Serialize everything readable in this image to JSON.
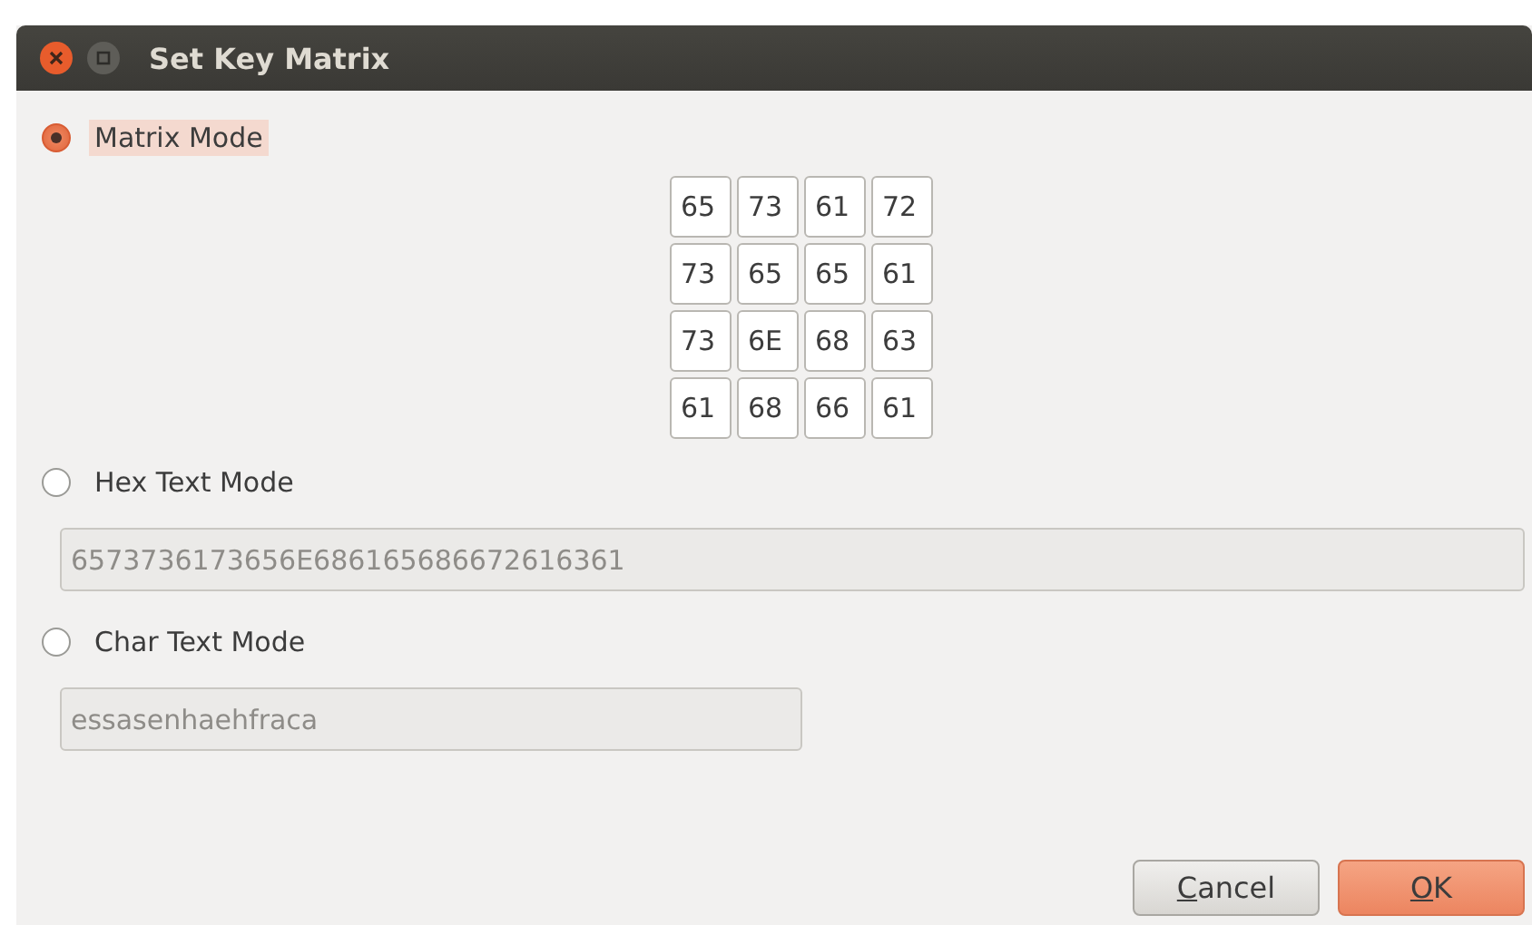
{
  "window": {
    "title": "Set Key Matrix"
  },
  "modes": [
    {
      "kind": "matrix",
      "label": "Matrix Mode",
      "selected": true,
      "focused": true,
      "matrix": [
        [
          "65",
          "73",
          "61",
          "72"
        ],
        [
          "73",
          "65",
          "65",
          "61"
        ],
        [
          "73",
          "6E",
          "68",
          "63"
        ],
        [
          "61",
          "68",
          "66",
          "61"
        ]
      ]
    },
    {
      "kind": "field",
      "label": "Hex Text Mode",
      "selected": false,
      "focused": false,
      "value": "6573736173656E686165686672616361",
      "disabled": true,
      "wide": true
    },
    {
      "kind": "field",
      "label": "Char Text Mode",
      "selected": false,
      "focused": false,
      "value": "essasenhaehfraca",
      "disabled": true,
      "wide": false
    }
  ],
  "buttons": [
    {
      "label": "Cancel",
      "mnemonic_underlined": true,
      "default": false
    },
    {
      "label": "OK",
      "mnemonic_underlined": true,
      "default": true
    }
  ]
}
